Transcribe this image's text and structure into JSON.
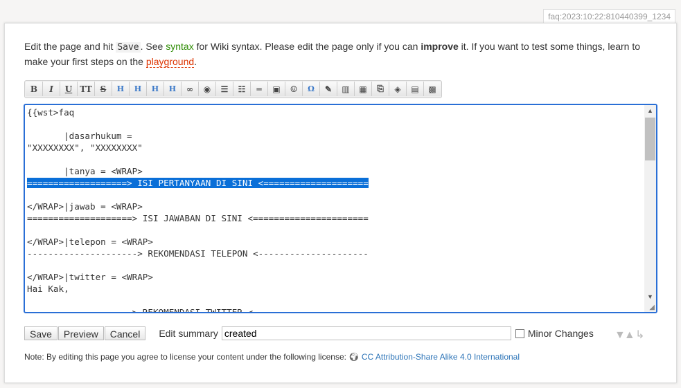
{
  "page_id": "faq:2023:10:22:810440399_1234",
  "intro": {
    "t1": "Edit the page and hit ",
    "save_code": "Save",
    "t2": ". See ",
    "syntax_link": "syntax",
    "t3": " for Wiki syntax. Please edit the page only if you can ",
    "improve": "improve",
    "t4": " it. If you want to test some things, learn to make your first steps on the ",
    "playground_link": "playground",
    "t5": "."
  },
  "toolbar": [
    {
      "icon": "bold-icon",
      "glyph": "B"
    },
    {
      "icon": "italic-icon",
      "glyph": "I"
    },
    {
      "icon": "underline-icon",
      "glyph": "U"
    },
    {
      "icon": "monospace-icon",
      "glyph": "TT"
    },
    {
      "icon": "strikethrough-icon",
      "glyph": "S"
    },
    {
      "icon": "heading-same-icon",
      "glyph": "H"
    },
    {
      "icon": "heading-lower-icon",
      "glyph": "H"
    },
    {
      "icon": "heading-higher-icon",
      "glyph": "H"
    },
    {
      "icon": "heading-select-icon",
      "glyph": "H"
    },
    {
      "icon": "link-icon",
      "glyph": "∞"
    },
    {
      "icon": "external-link-icon",
      "glyph": "◉"
    },
    {
      "icon": "ordered-list-icon",
      "glyph": "☰"
    },
    {
      "icon": "unordered-list-icon",
      "glyph": "☷"
    },
    {
      "icon": "horizontal-rule-icon",
      "glyph": "═"
    },
    {
      "icon": "image-icon",
      "glyph": "▣"
    },
    {
      "icon": "smiley-icon",
      "glyph": "☺"
    },
    {
      "icon": "special-chars-icon",
      "glyph": "Ω"
    },
    {
      "icon": "signature-icon",
      "glyph": "✎"
    },
    {
      "icon": "table-icon",
      "glyph": "▥"
    },
    {
      "icon": "settings-icon",
      "glyph": "▦"
    },
    {
      "icon": "clip-icon",
      "glyph": "⎘"
    },
    {
      "icon": "box-icon",
      "glyph": "◈"
    },
    {
      "icon": "folder-icon",
      "glyph": "▤"
    },
    {
      "icon": "clapperboard-icon",
      "glyph": "▩"
    }
  ],
  "editor": {
    "lines": [
      "{{wst>faq",
      "",
      "       |dasarhukum =",
      "\"XXXXXXXX\", \"XXXXXXXX\"",
      "",
      "       |tanya = <WRAP>",
      "===================> ISI PERTANYAAN DI SINI <====================",
      "",
      "</WRAP>|jawab = <WRAP>",
      "====================> ISI JAWABAN DI SINI <======================",
      "",
      "</WRAP>|telepon = <WRAP>",
      "---------------------> REKOMENDASI TELEPON <---------------------",
      "",
      "</WRAP>|twitter = <WRAP>",
      "Hai Kak,",
      "",
      "                    > REKOMENDASI TWITTER <"
    ],
    "selected_line": 6
  },
  "buttons": {
    "save": "Save",
    "preview": "Preview",
    "cancel": "Cancel"
  },
  "summary": {
    "label": "Edit summary",
    "value": "created"
  },
  "minor": {
    "label": "Minor Changes",
    "checked": false
  },
  "license": {
    "text": "Note: By editing this page you agree to license your content under the following license:",
    "link": "CC Attribution-Share Alike 4.0 International"
  },
  "colors": {
    "accent": "#2a6fd6",
    "selection": "#0a6fd8",
    "link": "#2b73b7"
  }
}
